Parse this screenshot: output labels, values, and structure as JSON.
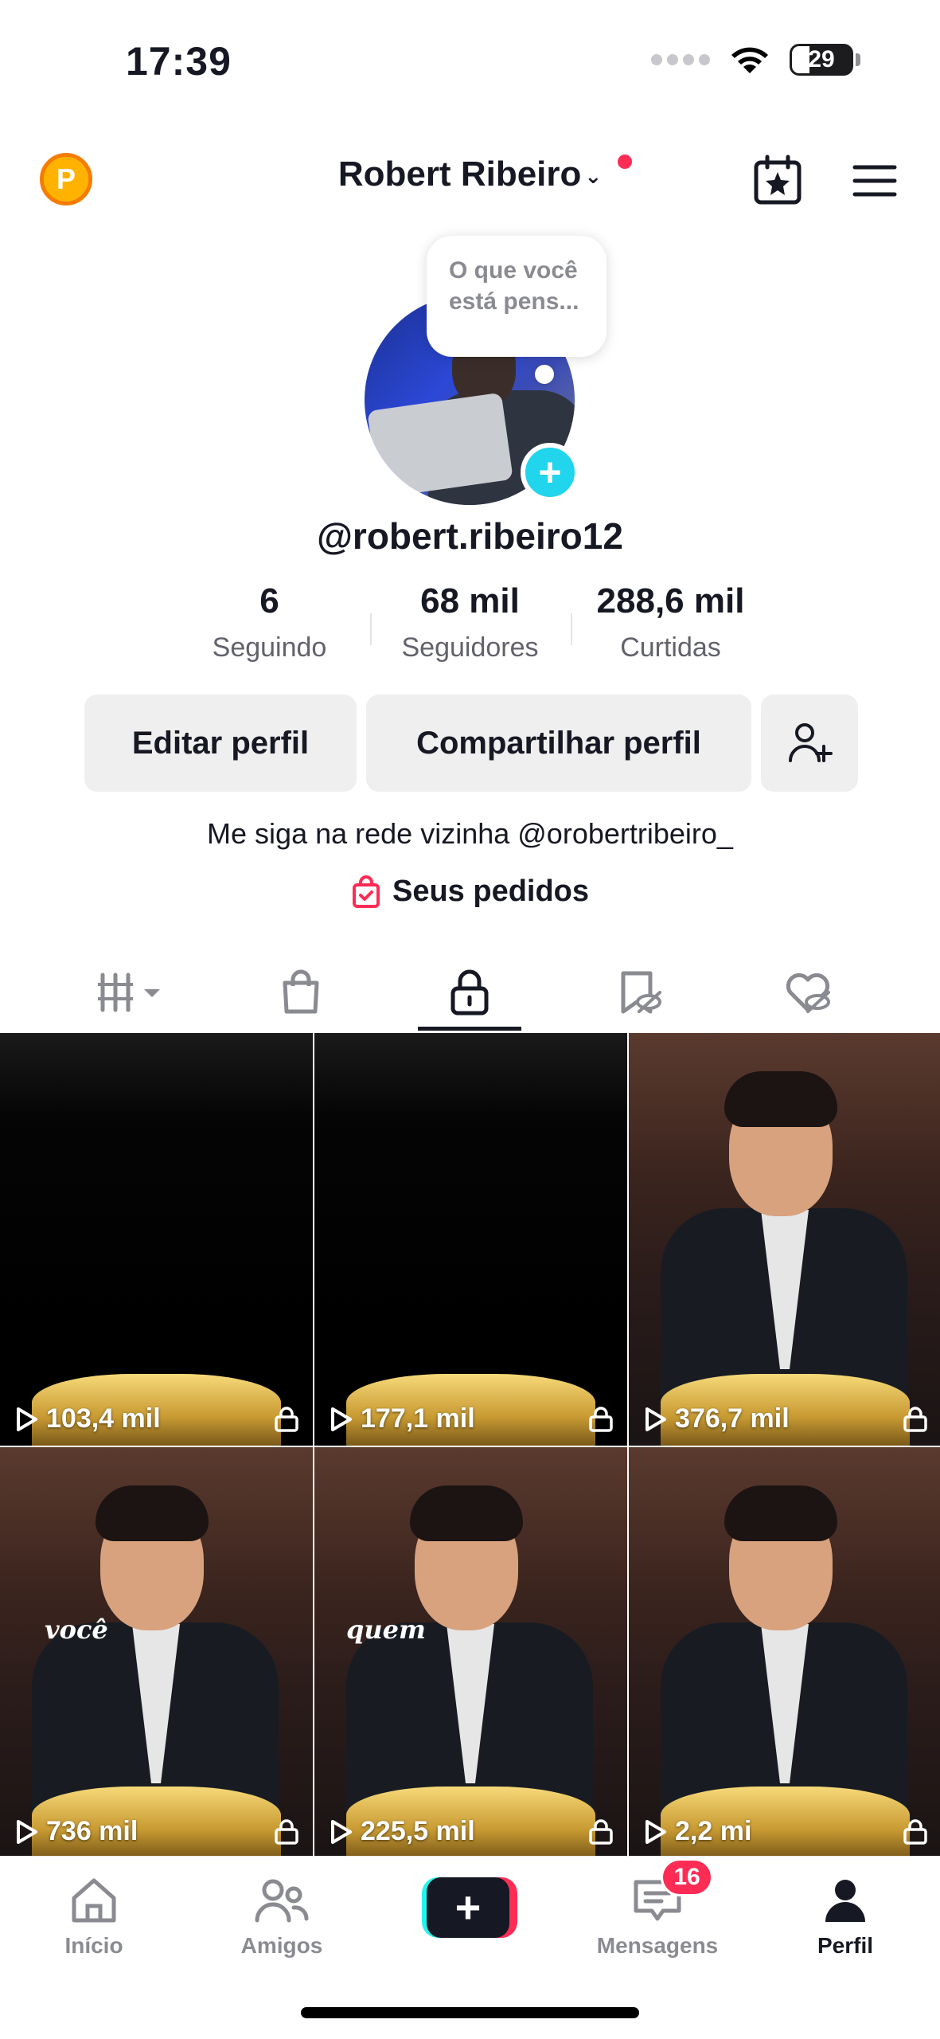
{
  "status_bar": {
    "time": "17:39",
    "battery": "29"
  },
  "header": {
    "coin_letter": "P",
    "title": "Robert Ribeiro",
    "caret": "⌄"
  },
  "profile": {
    "thought": "O que você está pens...",
    "username": "@robert.ribeiro12",
    "stats": [
      {
        "value": "6",
        "label": "Seguindo"
      },
      {
        "value": "68 mil",
        "label": "Seguidores"
      },
      {
        "value": "288,6 mil",
        "label": "Curtidas"
      }
    ],
    "buttons": {
      "edit": "Editar perfil",
      "share": "Compartilhar perfil"
    },
    "bio": "Me siga na rede vizinha @orobertribeiro_",
    "orders": "Seus pedidos"
  },
  "videos": [
    {
      "views": "103,4 mil",
      "caption": ""
    },
    {
      "views": "177,1 mil",
      "caption": ""
    },
    {
      "views": "376,7 mil",
      "caption": ""
    },
    {
      "views": "736 mil",
      "caption": "você"
    },
    {
      "views": "225,5 mil",
      "caption": "quem"
    },
    {
      "views": "2,2 mi",
      "caption": ""
    }
  ],
  "nav": {
    "home": "Início",
    "friends": "Amigos",
    "messages": "Mensagens",
    "messages_badge": "16",
    "profile": "Perfil"
  },
  "colors": {
    "accent": "#fe2c55",
    "cyan": "#20d5ec"
  }
}
